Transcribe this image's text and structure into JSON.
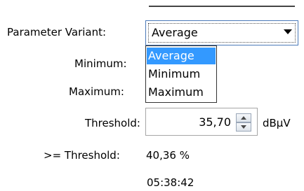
{
  "parameter_variant": {
    "label": "Parameter Variant:",
    "selected": "Average",
    "options": [
      "Average",
      "Minimum",
      "Maximum"
    ]
  },
  "minimum": {
    "label": "Minimum:"
  },
  "maximum": {
    "label": "Maximum:"
  },
  "threshold": {
    "label": "Threshold:",
    "value": "35,70",
    "unit": "dBµV"
  },
  "above_threshold": {
    "label": ">= Threshold:",
    "value": "40,36 %"
  },
  "duration": {
    "value": "05:38:42"
  },
  "colors": {
    "highlight": "#3399ff",
    "border": "#4b7ab8"
  }
}
